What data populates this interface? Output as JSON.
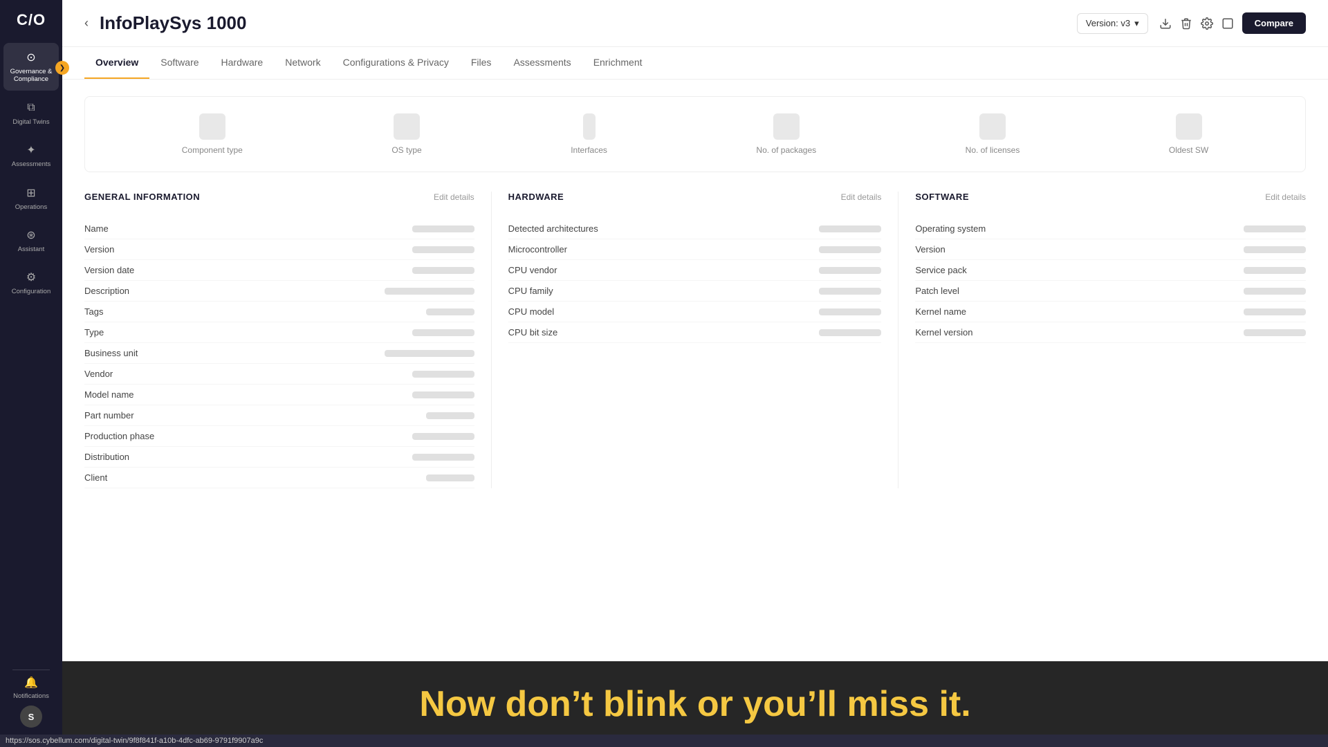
{
  "sidebar": {
    "logo": "C/O",
    "toggle_icon": "❯",
    "items": [
      {
        "id": "governance",
        "label": "Governance & Compliance",
        "icon": "⊙",
        "active": true
      },
      {
        "id": "digital-twins",
        "label": "Digital Twins",
        "icon": "⧉",
        "active": false
      },
      {
        "id": "assessments",
        "label": "Assessments",
        "icon": "✦",
        "active": false
      },
      {
        "id": "operations",
        "label": "Operations",
        "icon": "⊞",
        "active": false
      },
      {
        "id": "assistant",
        "label": "Assistant",
        "icon": "⊛",
        "active": false
      },
      {
        "id": "configuration",
        "label": "Configuration",
        "icon": "⚙",
        "active": false
      }
    ],
    "notifications_label": "Notifications",
    "notifications_icon": "🔔",
    "avatar_label": "S"
  },
  "header": {
    "back_icon": "‹",
    "title": "InfoPlaySys 1000",
    "version_label": "Version: v3",
    "version_chevron": "▾",
    "actions": {
      "download_icon": "↓",
      "trash_icon": "🗑",
      "settings_icon": "⚙",
      "expand_icon": "⬜",
      "compare_label": "Compare"
    }
  },
  "tabs": [
    {
      "id": "overview",
      "label": "Overview",
      "active": true
    },
    {
      "id": "software",
      "label": "Software",
      "active": false
    },
    {
      "id": "hardware",
      "label": "Hardware",
      "active": false
    },
    {
      "id": "network",
      "label": "Network",
      "active": false
    },
    {
      "id": "configurations",
      "label": "Configurations & Privacy",
      "active": false
    },
    {
      "id": "files",
      "label": "Files",
      "active": false
    },
    {
      "id": "assessments",
      "label": "Assessments",
      "active": false
    },
    {
      "id": "enrichment",
      "label": "Enrichment",
      "active": false
    }
  ],
  "stats": [
    {
      "id": "component-type",
      "label": "Component type"
    },
    {
      "id": "os-type",
      "label": "OS type"
    },
    {
      "id": "interfaces",
      "label": "Interfaces"
    },
    {
      "id": "packages",
      "label": "No. of packages"
    },
    {
      "id": "licenses",
      "label": "No. of licenses"
    },
    {
      "id": "oldest-sw",
      "label": "Oldest SW"
    }
  ],
  "general_info": {
    "title": "GENERAL INFORMATION",
    "edit_label": "Edit details",
    "fields": [
      {
        "label": "Name",
        "size": "medium"
      },
      {
        "label": "Version",
        "size": "medium"
      },
      {
        "label": "Version date",
        "size": "medium"
      },
      {
        "label": "Description",
        "size": "long"
      },
      {
        "label": "Tags",
        "size": "short"
      },
      {
        "label": "Type",
        "size": "medium"
      },
      {
        "label": "Business unit",
        "size": "long"
      },
      {
        "label": "Vendor",
        "size": "medium"
      },
      {
        "label": "Model name",
        "size": "medium"
      },
      {
        "label": "Part number",
        "size": "short"
      },
      {
        "label": "Production phase",
        "size": "medium"
      },
      {
        "label": "Distribution",
        "size": "medium"
      },
      {
        "label": "Client",
        "size": "short"
      }
    ]
  },
  "hardware": {
    "title": "HARDWARE",
    "edit_label": "Edit details",
    "fields": [
      {
        "label": "Detected architectures",
        "size": "medium"
      },
      {
        "label": "Microcontroller",
        "size": "medium"
      },
      {
        "label": "CPU vendor",
        "size": "medium"
      },
      {
        "label": "CPU family",
        "size": "medium"
      },
      {
        "label": "CPU model",
        "size": "medium"
      },
      {
        "label": "CPU bit size",
        "size": "medium"
      }
    ]
  },
  "software": {
    "title": "SOFTWARE",
    "edit_label": "Edit details",
    "fields": [
      {
        "label": "Operating system",
        "size": "medium"
      },
      {
        "label": "Version",
        "size": "medium"
      },
      {
        "label": "Service pack",
        "size": "medium"
      },
      {
        "label": "Patch level",
        "size": "medium"
      },
      {
        "label": "Kernel name",
        "size": "medium"
      },
      {
        "label": "Kernel version",
        "size": "medium"
      }
    ]
  },
  "overlay": {
    "text": "Now don’t blink or you’ll miss it."
  },
  "url_bar": {
    "url": "https://sos.cybellum.com/digital-twin/9f8f841f-a10b-4dfc-ab69-9791f9907a9c"
  }
}
